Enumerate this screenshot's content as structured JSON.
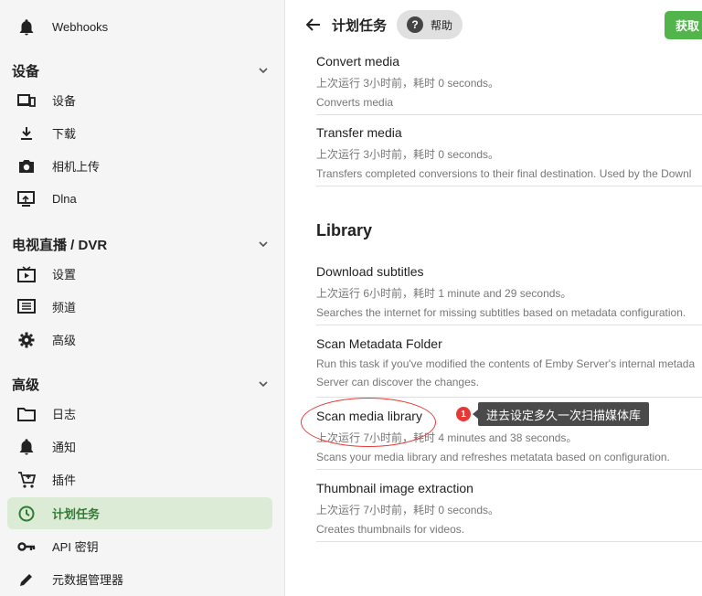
{
  "sidebar": {
    "webhooks": "Webhooks",
    "sections": {
      "devices": "设备",
      "livetv": "电视直播 / DVR",
      "advanced": "高级"
    },
    "devices_items": [
      "设备",
      "下载",
      "相机上传",
      "Dlna"
    ],
    "livetv_items": [
      "设置",
      "频道",
      "高级"
    ],
    "advanced_items": [
      "日志",
      "通知",
      "插件",
      "计划任务",
      "API 密钥",
      "元数据管理器"
    ]
  },
  "header": {
    "title": "计划任务",
    "help": "帮助",
    "help_glyph": "?",
    "get_button": "获取"
  },
  "tasks_top": [
    {
      "name": "Convert media",
      "status": "上次运行 3小时前，耗时 0 seconds。",
      "desc": "Converts media"
    },
    {
      "name": "Transfer media",
      "status": "上次运行 3小时前，耗时 0 seconds。",
      "desc": "Transfers completed conversions to their final destination. Used by the Downl"
    }
  ],
  "library": {
    "title": "Library",
    "tasks": [
      {
        "name": "Download subtitles",
        "status": "上次运行 6小时前，耗时 1 minute and 29 seconds。",
        "desc": "Searches the internet for missing subtitles based on metadata configuration."
      },
      {
        "name": "Scan Metadata Folder",
        "status": "Run this task if you've modified the contents of Emby Server's internal metada",
        "desc": "Server can discover the changes."
      },
      {
        "name": "Scan media library",
        "status": "上次运行 7小时前，耗时 4 minutes and 38 seconds。",
        "desc": "Scans your media library and refreshes metatata based on configuration."
      },
      {
        "name": "Thumbnail image extraction",
        "status": "上次运行 7小时前，耗时 0 seconds。",
        "desc": "Creates thumbnails for videos."
      }
    ]
  },
  "annotation": {
    "badge": "1",
    "text": "进去设定多久一次扫描媒体库"
  },
  "colors": {
    "accent": "#52b54b",
    "active_bg": "#dcebd6",
    "annotation_red": "#e53935"
  }
}
